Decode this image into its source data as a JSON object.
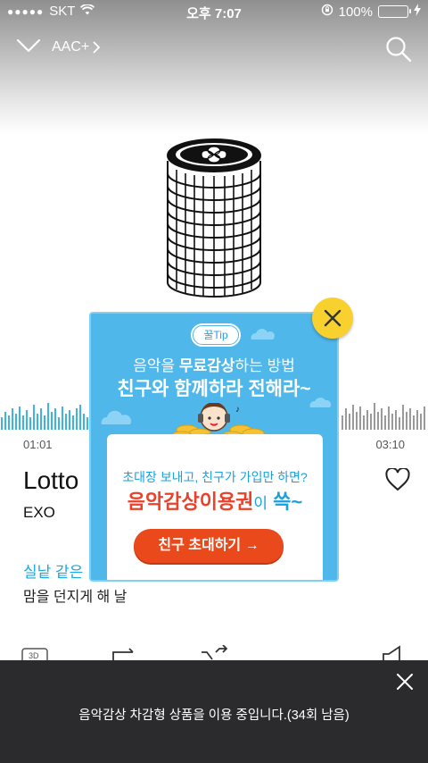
{
  "status_bar": {
    "carrier": "SKT",
    "signal_dots": "●●●●●",
    "time": "오후 7:07",
    "battery": "100%"
  },
  "topbar": {
    "quality_label": "AAC+"
  },
  "player": {
    "elapsed": "01:01",
    "duration": "03:10",
    "song_title": "Lotto",
    "artist": "EXO",
    "lyric_current": "실낱 같은",
    "lyric_next": "맘을 던지게 해 날"
  },
  "popup": {
    "tip_badge": "꿀Tip",
    "line1_pre": "음악을 ",
    "line1_bold": "무료감상",
    "line1_post": "하는 방법",
    "line2": "친구와 함께하라 전해라~",
    "card_sub": "초대장 보내고, 친구가 가입만 하면?",
    "card_big": "음악감상이용권",
    "card_big_particle": "이",
    "card_big_end": " 쓱~",
    "invite_button": "친구 초대하기 →"
  },
  "toast": {
    "message": "음악감상 차감형 상품을 이용 중입니다.(34회 남음)"
  },
  "colors": {
    "accent_blue": "#1aa9e0",
    "popup_bg": "#4fb7ea",
    "invite_orange": "#ea4a1b",
    "close_yellow": "#f8d12f",
    "toast_bg": "#2b2b2d"
  }
}
